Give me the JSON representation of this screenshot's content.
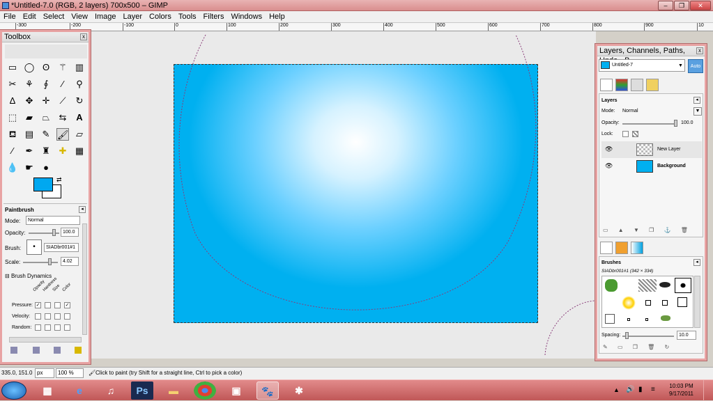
{
  "window": {
    "title": "*Untitled-7.0 (RGB, 2 layers) 700x500 – GIMP",
    "min": "–",
    "max": "❐",
    "close": "✕"
  },
  "menu": [
    "File",
    "Edit",
    "Select",
    "View",
    "Image",
    "Layer",
    "Colors",
    "Tools",
    "Filters",
    "Windows",
    "Help"
  ],
  "ruler": {
    "ticks": [
      "-300",
      "-200",
      "-100",
      "0",
      "100",
      "200",
      "300",
      "400",
      "500",
      "600",
      "700",
      "800",
      "900",
      "10"
    ]
  },
  "toolbox": {
    "title": "Toolbox",
    "tool_options": {
      "name": "Paintbrush",
      "mode_label": "Mode:",
      "mode": "Normal",
      "opacity_label": "Opacity:",
      "opacity": "100.0",
      "brush_label": "Brush:",
      "brush": "SIADbr001#1",
      "scale_label": "Scale:",
      "scale": "4.02",
      "dynamics_label": "Brush Dynamics",
      "dyn_cols": [
        "Opacity",
        "Hardness",
        "Size",
        "Color"
      ],
      "dyn_rows": [
        "Pressure:",
        "Velocity:",
        "Random:"
      ]
    },
    "fg_color": "#00a8f0",
    "bg_color": "#ffffff"
  },
  "dock": {
    "title": "Layers, Channels, Paths, Undo - B...",
    "image_select": "Untitled-7",
    "auto": "Auto",
    "layers": {
      "heading": "Layers",
      "mode_label": "Mode:",
      "mode": "Normal",
      "opacity_label": "Opacity:",
      "opacity": "100.0",
      "lock_label": "Lock:",
      "items": [
        {
          "name": "New Layer"
        },
        {
          "name": "Background",
          "color": "#00b0f0"
        }
      ]
    },
    "brushes": {
      "heading": "Brushes",
      "selected": "SIADbr001#1 (342 × 334)",
      "spacing_label": "Spacing:",
      "spacing": "10.0"
    }
  },
  "status": {
    "coords": "335.0, 151.0",
    "unit": "px",
    "zoom": "100 %",
    "message": "Click to paint (try Shift for a straight line, Ctrl to pick a color)"
  },
  "taskbar": {
    "ps": "Ps",
    "time": "10:03 PM",
    "date": "9/17/2011"
  }
}
